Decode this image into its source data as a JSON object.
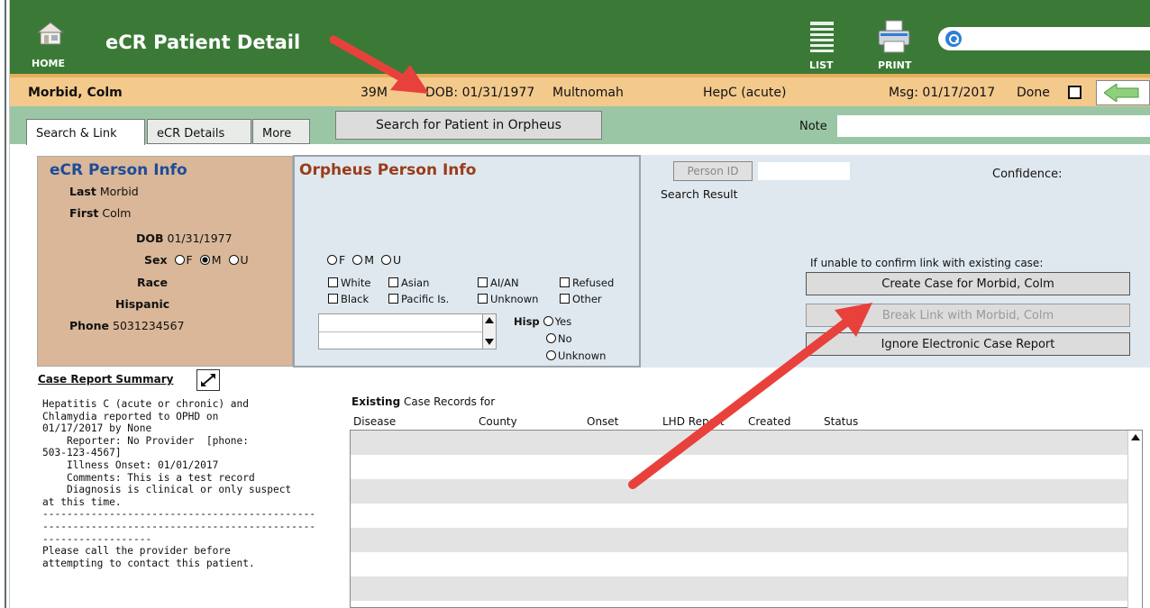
{
  "header": {
    "title": "eCR Patient Detail",
    "home_label": "HOME",
    "list_label": "LIST",
    "print_label": "PRINT",
    "search_placeholder": ""
  },
  "patient_bar": {
    "name": "Morbid, Colm",
    "age_sex": "39M",
    "dob": "DOB: 01/31/1977",
    "county": "Multnomah",
    "disease": "HepC (acute)",
    "msg": "Msg: 01/17/2017",
    "done_label": "Done"
  },
  "tabs": [
    {
      "label": "Search & Link"
    },
    {
      "label": "eCR Details"
    },
    {
      "label": "More"
    }
  ],
  "search_patient_button": "Search for Patient in Orpheus",
  "note_label": "Note",
  "ecr_person": {
    "title": "eCR Person Info",
    "last_label": "Last",
    "last_value": "Morbid",
    "first_label": "First",
    "first_value": "Colm",
    "dob_label": "DOB",
    "dob_value": "01/31/1977",
    "sex_label": "Sex",
    "sex_options": [
      "F",
      "M",
      "U"
    ],
    "sex_selected": "M",
    "race_label": "Race",
    "hispanic_label": "Hispanic",
    "phone_label": "Phone",
    "phone_value": "5031234567"
  },
  "orpheus_person": {
    "title": "Orpheus Person Info",
    "sex_options": [
      "F",
      "M",
      "U"
    ],
    "race_options": [
      "White",
      "Asian",
      "AI/AN",
      "Refused",
      "Black",
      "Pacific Is.",
      "Unknown",
      "Other"
    ],
    "hisp_label": "Hisp",
    "hisp_options": [
      "Yes",
      "No",
      "Unknown"
    ]
  },
  "search_result": {
    "person_id_button": "Person ID",
    "label": "Search Result",
    "confidence_label": "Confidence:",
    "unable_text": "If unable to confirm link with existing case:",
    "create_button": "Create Case for Morbid, Colm",
    "break_button": "Break Link with Morbid, Colm",
    "ignore_button": "Ignore Electronic Case Report"
  },
  "case_summary": {
    "title": "Case Report Summary",
    "text": "Hepatitis C (acute or chronic) and\nChlamydia reported to OPHD on\n01/17/2017 by None\n    Reporter: No Provider  [phone:\n503-123-4567]\n    Illness Onset: 01/01/2017\n    Comments: This is a test record\n    Diagnosis is clinical or only suspect\nat this time.\n---------------------------------------------\n---------------------------------------------\n------------------\nPlease call the provider before\nattempting to contact this patient."
  },
  "existing_records": {
    "title_bold": "Existing",
    "title_rest": " Case Records for",
    "columns": [
      "Disease",
      "County",
      "Onset",
      "LHD Report",
      "Created",
      "Status"
    ]
  },
  "colors": {
    "header_green": "#3b7a36",
    "patient_bar": "#f3c98c",
    "tabs_row": "#9bc6a5",
    "ecr_panel": "#d9b798",
    "orpheus_panel": "#dfe8ef",
    "annotation_arrow": "#e8413c"
  }
}
